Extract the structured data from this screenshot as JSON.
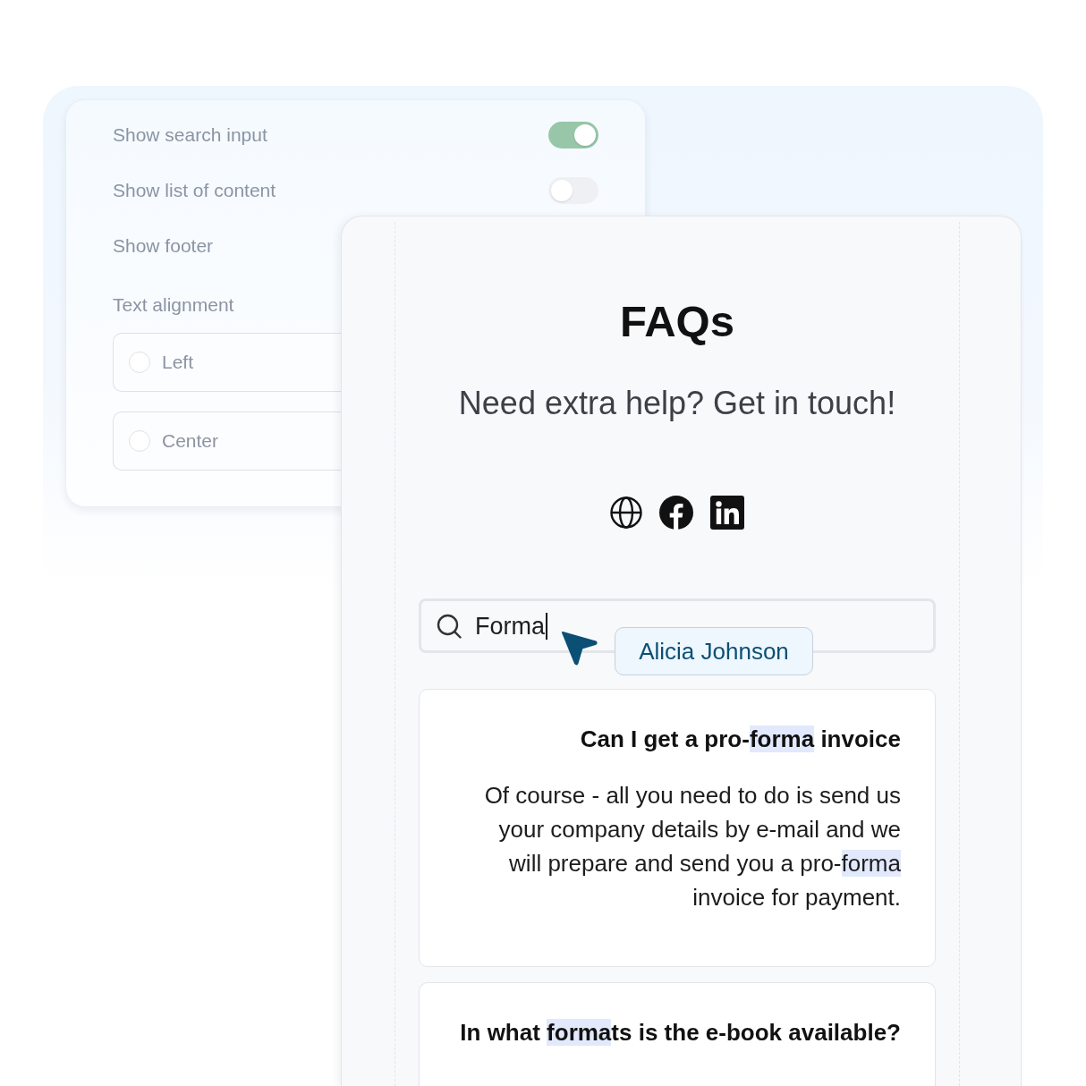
{
  "settings": {
    "rows": [
      {
        "label": "Show search input",
        "on": true
      },
      {
        "label": "Show list of content",
        "on": false
      },
      {
        "label": "Show footer"
      }
    ],
    "text_alignment": {
      "label": "Text alignment",
      "options": [
        {
          "label": "Left",
          "selected": false
        },
        {
          "label": "Center",
          "selected": false
        }
      ]
    }
  },
  "preview": {
    "title": "FAQs",
    "subtitle": "Need extra help? Get in touch!",
    "search": {
      "value": "Forma"
    },
    "collaborator": {
      "name": "Alicia Johnson"
    },
    "faqs": [
      {
        "question": [
          {
            "text": "Can I get a pro-",
            "highlighted": false
          },
          {
            "text": "forma",
            "highlighted": true
          },
          {
            "text": " invoice",
            "highlighted": false
          }
        ],
        "answer": [
          {
            "text": "Of course - all you need to do is send us your company details by e-mail and we will prepare and send you a pro-",
            "highlighted": false
          },
          {
            "text": "forma",
            "highlighted": true
          },
          {
            "text": " invoice for payment.",
            "highlighted": false
          }
        ]
      },
      {
        "question": [
          {
            "text": "In what ",
            "highlighted": false
          },
          {
            "text": "forma",
            "highlighted": true
          },
          {
            "text": "ts is the e-book available?",
            "highlighted": false
          }
        ]
      }
    ]
  }
}
